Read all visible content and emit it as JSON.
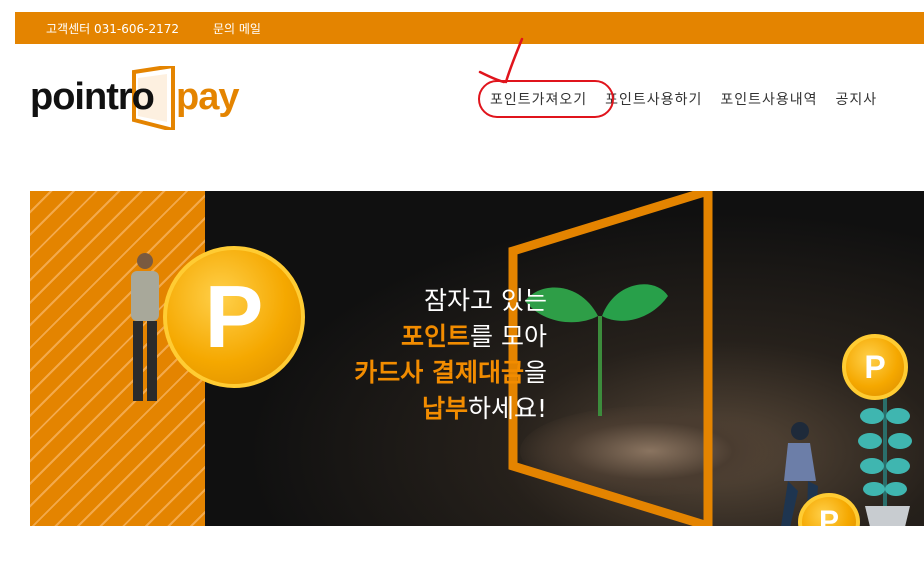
{
  "topbar": {
    "contact": "고객센터 031-606-2172",
    "email": "문의 메일"
  },
  "logo": {
    "part1": "pointro",
    "part2": "pay"
  },
  "nav": {
    "items": [
      {
        "label": "포인트가져오기"
      },
      {
        "label": "포인트사용하기"
      },
      {
        "label": "포인트사용내역"
      },
      {
        "label": "공지사"
      }
    ]
  },
  "banner": {
    "line1": "잠자고 있는",
    "line2_highlight": "포인트",
    "line2_rest": "를 모아",
    "line3_highlight": "카드사 결제대금",
    "line3_rest": "을",
    "line4_highlight": "납부",
    "line4_rest": "하세요!",
    "coin_letter": "P"
  },
  "colors": {
    "accent": "#e48400",
    "highlight": "#f28c00",
    "annotation": "#e0141c"
  }
}
